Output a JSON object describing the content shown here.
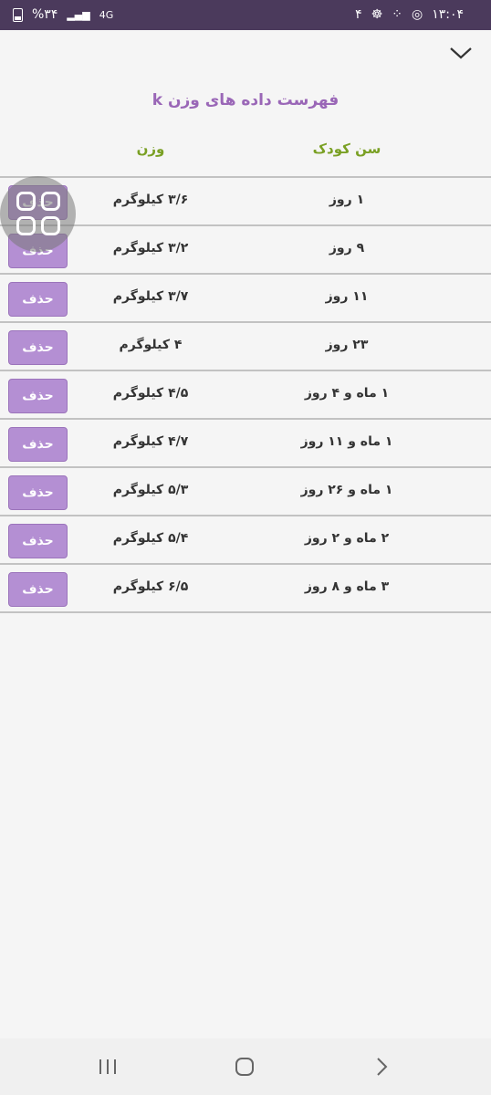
{
  "status_bar": {
    "time": "۱۳:۰۴",
    "notification_count": "۴",
    "battery": "%۳۴",
    "network": "4G"
  },
  "page": {
    "title": "فهرست داده های وزن k",
    "col_age": "سن کودک",
    "col_weight": "وزن"
  },
  "rows": [
    {
      "age": "۱ روز",
      "weight": "۳/۶ کیلوگرم",
      "delete": "حذف"
    },
    {
      "age": "۹ روز",
      "weight": "۳/۲ کیلوگرم",
      "delete": "حذف"
    },
    {
      "age": "۱۱ روز",
      "weight": "۳/۷ کیلوگرم",
      "delete": "حذف"
    },
    {
      "age": "۲۳ روز",
      "weight": "۴ کیلوگرم",
      "delete": "حذف"
    },
    {
      "age": "۱ ماه و ۴ روز",
      "weight": "۴/۵ کیلوگرم",
      "delete": "حذف"
    },
    {
      "age": "۱ ماه و ۱۱ روز",
      "weight": "۴/۷ کیلوگرم",
      "delete": "حذف"
    },
    {
      "age": "۱ ماه و ۲۶ روز",
      "weight": "۵/۳ کیلوگرم",
      "delete": "حذف"
    },
    {
      "age": "۲ ماه و ۲ روز",
      "weight": "۵/۴ کیلوگرم",
      "delete": "حذف"
    },
    {
      "age": "۳ ماه و ۸ روز",
      "weight": "۶/۵ کیلوگرم",
      "delete": "حذف"
    }
  ],
  "colors": {
    "accent": "#9a67b7",
    "header_green": "#7aa024",
    "button": "#b48fd3",
    "status_bar": "#4b3a5c"
  }
}
